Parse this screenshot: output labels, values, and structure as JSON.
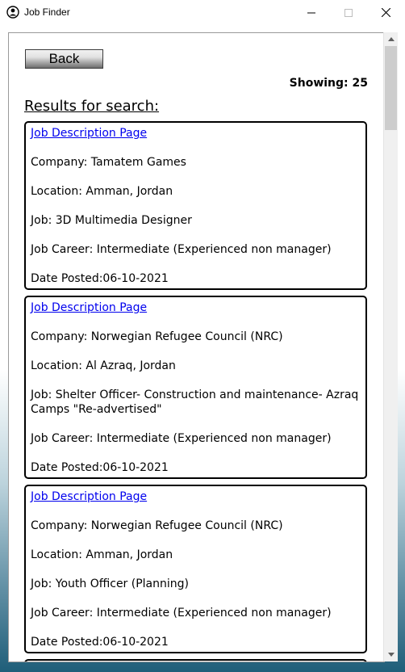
{
  "window": {
    "title": "Job Finder"
  },
  "toolbar": {
    "back_label": "Back"
  },
  "header": {
    "showing": "Showing: 25",
    "results_heading": "Results for search:"
  },
  "jobs": [
    {
      "link": "Job Description Page",
      "company": "Company: Tamatem Games",
      "location": "Location: Amman, Jordan",
      "job": "Job: 3D Multimedia Designer",
      "career": "Job Career: Intermediate (Experienced non manager)",
      "date": "Date Posted:06-10-2021"
    },
    {
      "link": "Job Description Page",
      "company": "Company: Norwegian Refugee Council (NRC)",
      "location": "Location: Al Azraq, Jordan",
      "job": "Job: Shelter Officer- Construction and maintenance- Azraq Camps \"Re-advertised\"",
      "career": "Job Career: Intermediate (Experienced non manager)",
      "date": "Date Posted:06-10-2021"
    },
    {
      "link": "Job Description Page",
      "company": "Company: Norwegian Refugee Council (NRC)",
      "location": "Location: Amman, Jordan",
      "job": "Job: Youth Officer (Planning)",
      "career": "Job Career: Intermediate (Experienced non manager)",
      "date": "Date Posted:06-10-2021"
    }
  ]
}
